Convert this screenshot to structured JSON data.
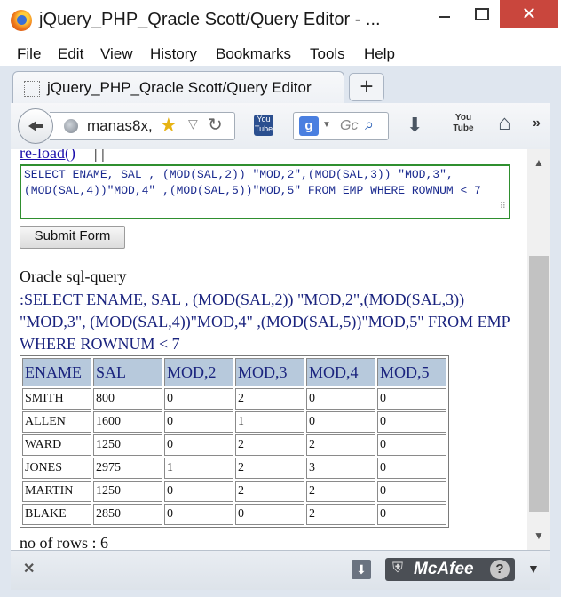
{
  "window": {
    "title": "jQuery_PHP_Qracle Scott/Query Editor - ...",
    "close_glyph": "✕"
  },
  "menu": {
    "items": [
      {
        "u": "F",
        "rest": "ile"
      },
      {
        "u": "E",
        "rest": "dit"
      },
      {
        "u": "V",
        "rest": "iew"
      },
      {
        "u": "",
        "pre": "Hi",
        "us": "s",
        "post": "tory"
      },
      {
        "u": "B",
        "rest": "ookmarks"
      },
      {
        "u": "T",
        "rest": "ools"
      },
      {
        "u": "H",
        "rest": "elp"
      }
    ]
  },
  "tab": {
    "title": "jQuery_PHP_Qracle Scott/Query Editor",
    "new_tab_label": "+"
  },
  "nav": {
    "url": "manas8x,",
    "search_placeholder": "Gc",
    "youtube_label": "You Tube",
    "google_label": "g"
  },
  "content": {
    "reload_link": "re-load()",
    "reload_sep": "| |",
    "query_text": "SELECT ENAME, SAL , (MOD(SAL,2)) \"MOD,2\",(MOD(SAL,3)) \"MOD,3\", (MOD(SAL,4))\"MOD,4\" ,(MOD(SAL,5))\"MOD,5\" FROM EMP WHERE ROWNUM < 7",
    "submit_label": "Submit Form",
    "heading": "Oracle sql-query",
    "query_echo": ":SELECT ENAME, SAL , (MOD(SAL,2)) \"MOD,2\",(MOD(SAL,3)) \"MOD,3\", (MOD(SAL,4))\"MOD,4\" ,(MOD(SAL,5))\"MOD,5\" FROM EMP WHERE ROWNUM < 7",
    "table": {
      "headers": [
        "ENAME",
        "SAL",
        "MOD,2",
        "MOD,3",
        "MOD,4",
        "MOD,5"
      ],
      "rows": [
        [
          "SMITH",
          "800",
          "0",
          "2",
          "0",
          "0"
        ],
        [
          "ALLEN",
          "1600",
          "0",
          "1",
          "0",
          "0"
        ],
        [
          "WARD",
          "1250",
          "0",
          "2",
          "2",
          "0"
        ],
        [
          "JONES",
          "2975",
          "1",
          "2",
          "3",
          "0"
        ],
        [
          "MARTIN",
          "1250",
          "0",
          "2",
          "2",
          "0"
        ],
        [
          "BLAKE",
          "2850",
          "0",
          "0",
          "2",
          "0"
        ]
      ]
    },
    "row_count": "no of rows : 6"
  },
  "addon": {
    "close": "✕",
    "mcafee_label": "McAfee",
    "help": "?"
  },
  "colors": {
    "query_border": "#2f8f2f",
    "header_bg": "#b7c9dc",
    "query_text": "#1a237e",
    "close_button": "#c9463d"
  }
}
